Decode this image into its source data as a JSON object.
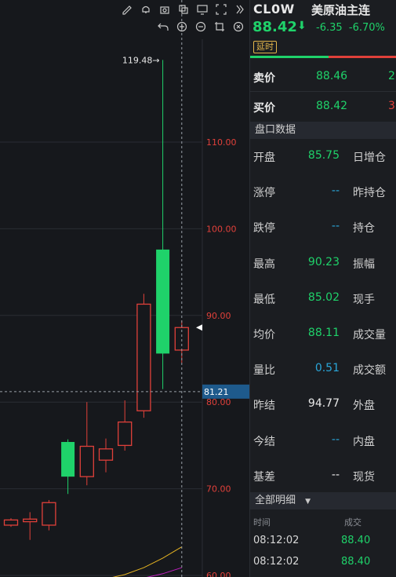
{
  "toolbar_top": [
    "pencil-icon",
    "bell-icon",
    "camera-icon",
    "layers-icon",
    "monitor-icon",
    "fullscreen-icon",
    "double-chevron-right-icon"
  ],
  "toolbar_second": [
    "undo-icon",
    "zoom-in-icon",
    "zoom-out-icon",
    "crop-icon",
    "close-circle-icon"
  ],
  "chart_data": {
    "type": "candlestick",
    "y_ticks": [
      "110.00",
      "100.00",
      "90.00",
      "80.00",
      "70.00",
      "60.00"
    ],
    "y_tick_values": [
      110,
      100,
      90,
      80,
      70,
      60
    ],
    "high_marker": "119.48→",
    "high_value": 119.48,
    "crosshair_price": "81.21",
    "crosshair_value": 81.21,
    "candles": [
      {
        "open": 65.8,
        "close": 66.4,
        "high": 66.6,
        "low": 65.6
      },
      {
        "open": 66.2,
        "close": 66.5,
        "high": 67.3,
        "low": 64.1
      },
      {
        "open": 65.8,
        "close": 68.4,
        "high": 68.7,
        "low": 65.2
      },
      {
        "open": 75.4,
        "close": 71.4,
        "high": 75.7,
        "low": 69.4
      },
      {
        "open": 71.4,
        "close": 74.9,
        "high": 80.0,
        "low": 70.4
      },
      {
        "open": 73.3,
        "close": 74.6,
        "high": 75.8,
        "low": 71.9
      },
      {
        "open": 75.0,
        "close": 77.7,
        "high": 80.2,
        "low": 74.4
      },
      {
        "open": 79.0,
        "close": 91.3,
        "high": 92.5,
        "low": 78.2
      },
      {
        "open": 97.6,
        "close": 85.6,
        "high": 119.48,
        "low": 81.5
      },
      {
        "open": 86.0,
        "close": 88.6,
        "high": 89.4,
        "low": 84.5
      }
    ],
    "ma_lines": [
      {
        "color": "#e6b422",
        "values": [
          58.2,
          58.4,
          58.6,
          58.9,
          59.2,
          59.6,
          60.1,
          60.9,
          62.0,
          63.3
        ]
      },
      {
        "color": "#c020c0",
        "values": [
          58.0,
          58.1,
          58.3,
          58.5,
          58.7,
          59.0,
          59.3,
          59.7,
          60.2,
          60.9
        ]
      }
    ],
    "up_color": "#e0403a",
    "down_color": "#1fd26a"
  },
  "quote": {
    "symbol": "CL0W",
    "name": "美原油主连",
    "last": "88.42",
    "arrow": "⬇",
    "change": "-6.35",
    "change_pct": "-6.70%",
    "delay_badge": "延时",
    "ask_label": "卖价",
    "ask_price": "88.46",
    "ask_vol": "2",
    "bid_label": "买价",
    "bid_price": "88.42",
    "bid_vol": "3",
    "section_title": "盘口数据",
    "stats": [
      {
        "label": "开盘",
        "value": "85.75",
        "color": "#1fd26a",
        "label2": "日增仓"
      },
      {
        "label": "涨停",
        "value": "--",
        "color": "#2aa6d9",
        "label2": "昨持仓"
      },
      {
        "label": "跌停",
        "value": "--",
        "color": "#2aa6d9",
        "label2": "持仓"
      },
      {
        "label": "最高",
        "value": "90.23",
        "color": "#1fd26a",
        "label2": "振幅"
      },
      {
        "label": "最低",
        "value": "85.02",
        "color": "#1fd26a",
        "label2": "现手"
      },
      {
        "label": "均价",
        "value": "88.11",
        "color": "#1fd26a",
        "label2": "成交量"
      },
      {
        "label": "量比",
        "value": "0.51",
        "color": "#2aa6d9",
        "label2": "成交额"
      },
      {
        "label": "昨结",
        "value": "94.77",
        "color": "#e8e8e8",
        "label2": "外盘"
      },
      {
        "label": "今结",
        "value": "--",
        "color": "#2aa6d9",
        "label2": "内盘"
      },
      {
        "label": "基差",
        "value": "--",
        "color": "#e8e8e8",
        "label2": "现货"
      }
    ],
    "detail_title": "全部明细",
    "detail_head_time": "时间",
    "detail_head_trade": "成交",
    "trades": [
      {
        "time": "08:12:02",
        "price": "88.40"
      },
      {
        "time": "08:12:02",
        "price": "88.40"
      }
    ]
  }
}
